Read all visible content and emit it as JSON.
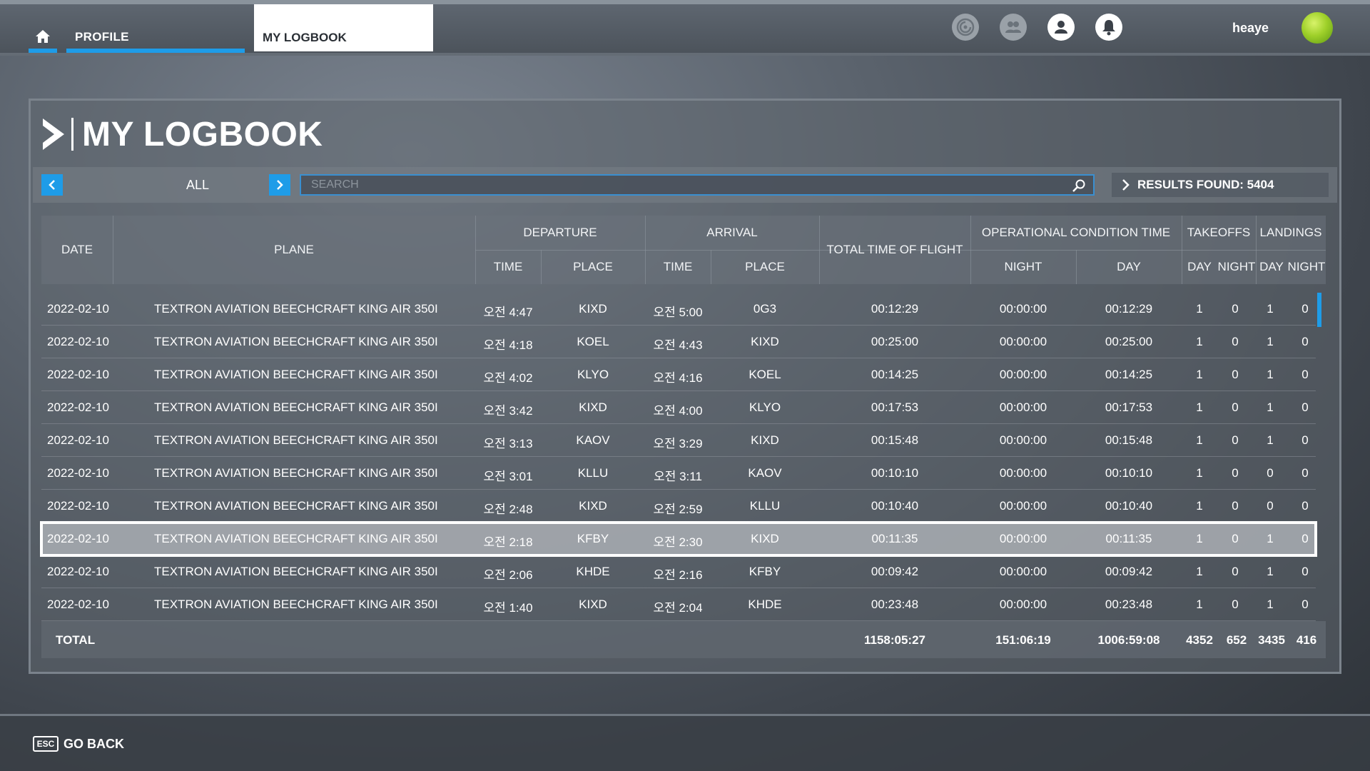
{
  "topbar": {
    "tabs": [
      {
        "label": "PROFILE"
      },
      {
        "label": "MY LOGBOOK"
      }
    ],
    "username": "heaye",
    "icons": [
      "home-icon",
      "activity-icon",
      "friends-icon",
      "profile-icon",
      "notification-icon"
    ]
  },
  "page": {
    "title": "MY LOGBOOK"
  },
  "filter": {
    "label": "ALL",
    "search_placeholder": "SEARCH",
    "results": "RESULTS FOUND: 5404"
  },
  "table": {
    "headers": {
      "date": "DATE",
      "plane": "PLANE",
      "departure": "DEPARTURE",
      "arrival": "ARRIVAL",
      "total_time": "TOTAL TIME OF FLIGHT",
      "op_time": "OPERATIONAL CONDITION TIME",
      "takeoffs": "TAKEOFFS",
      "landings": "LANDINGS",
      "time": "TIME",
      "place": "PLACE",
      "night": "NIGHT",
      "day": "DAY",
      "day_short": "DAY",
      "night_short": "NIGHT"
    },
    "rows": [
      {
        "date": "2022-02-10",
        "plane": "TEXTRON AVIATION BEECHCRAFT KING AIR 350I",
        "dep_time": "오전 4:47",
        "dep_place": "KIXD",
        "arr_time": "오전 5:00",
        "arr_place": "0G3",
        "total": "00:12:29",
        "night": "00:00:00",
        "day": "00:12:29",
        "to_day": "1",
        "to_night": "0",
        "ld_day": "1",
        "ld_night": "0"
      },
      {
        "date": "2022-02-10",
        "plane": "TEXTRON AVIATION BEECHCRAFT KING AIR 350I",
        "dep_time": "오전 4:18",
        "dep_place": "KOEL",
        "arr_time": "오전 4:43",
        "arr_place": "KIXD",
        "total": "00:25:00",
        "night": "00:00:00",
        "day": "00:25:00",
        "to_day": "1",
        "to_night": "0",
        "ld_day": "1",
        "ld_night": "0"
      },
      {
        "date": "2022-02-10",
        "plane": "TEXTRON AVIATION BEECHCRAFT KING AIR 350I",
        "dep_time": "오전 4:02",
        "dep_place": "KLYO",
        "arr_time": "오전 4:16",
        "arr_place": "KOEL",
        "total": "00:14:25",
        "night": "00:00:00",
        "day": "00:14:25",
        "to_day": "1",
        "to_night": "0",
        "ld_day": "1",
        "ld_night": "0"
      },
      {
        "date": "2022-02-10",
        "plane": "TEXTRON AVIATION BEECHCRAFT KING AIR 350I",
        "dep_time": "오전 3:42",
        "dep_place": "KIXD",
        "arr_time": "오전 4:00",
        "arr_place": "KLYO",
        "total": "00:17:53",
        "night": "00:00:00",
        "day": "00:17:53",
        "to_day": "1",
        "to_night": "0",
        "ld_day": "1",
        "ld_night": "0"
      },
      {
        "date": "2022-02-10",
        "plane": "TEXTRON AVIATION BEECHCRAFT KING AIR 350I",
        "dep_time": "오전 3:13",
        "dep_place": "KAOV",
        "arr_time": "오전 3:29",
        "arr_place": "KIXD",
        "total": "00:15:48",
        "night": "00:00:00",
        "day": "00:15:48",
        "to_day": "1",
        "to_night": "0",
        "ld_day": "1",
        "ld_night": "0"
      },
      {
        "date": "2022-02-10",
        "plane": "TEXTRON AVIATION BEECHCRAFT KING AIR 350I",
        "dep_time": "오전 3:01",
        "dep_place": "KLLU",
        "arr_time": "오전 3:11",
        "arr_place": "KAOV",
        "total": "00:10:10",
        "night": "00:00:00",
        "day": "00:10:10",
        "to_day": "1",
        "to_night": "0",
        "ld_day": "0",
        "ld_night": "0"
      },
      {
        "date": "2022-02-10",
        "plane": "TEXTRON AVIATION BEECHCRAFT KING AIR 350I",
        "dep_time": "오전 2:48",
        "dep_place": "KIXD",
        "arr_time": "오전 2:59",
        "arr_place": "KLLU",
        "total": "00:10:40",
        "night": "00:00:00",
        "day": "00:10:40",
        "to_day": "1",
        "to_night": "0",
        "ld_day": "0",
        "ld_night": "0"
      },
      {
        "date": "2022-02-10",
        "plane": "TEXTRON AVIATION BEECHCRAFT KING AIR 350I",
        "dep_time": "오전 2:18",
        "dep_place": "KFBY",
        "arr_time": "오전 2:30",
        "arr_place": "KIXD",
        "total": "00:11:35",
        "night": "00:00:00",
        "day": "00:11:35",
        "to_day": "1",
        "to_night": "0",
        "ld_day": "1",
        "ld_night": "0"
      },
      {
        "date": "2022-02-10",
        "plane": "TEXTRON AVIATION BEECHCRAFT KING AIR 350I",
        "dep_time": "오전 2:06",
        "dep_place": "KHDE",
        "arr_time": "오전 2:16",
        "arr_place": "KFBY",
        "total": "00:09:42",
        "night": "00:00:00",
        "day": "00:09:42",
        "to_day": "1",
        "to_night": "0",
        "ld_day": "1",
        "ld_night": "0"
      },
      {
        "date": "2022-02-10",
        "plane": "TEXTRON AVIATION BEECHCRAFT KING AIR 350I",
        "dep_time": "오전 1:40",
        "dep_place": "KIXD",
        "arr_time": "오전 2:04",
        "arr_place": "KHDE",
        "total": "00:23:48",
        "night": "00:00:00",
        "day": "00:23:48",
        "to_day": "1",
        "to_night": "0",
        "ld_day": "1",
        "ld_night": "0"
      }
    ],
    "selected_row_index": 7,
    "totals": {
      "label": "TOTAL",
      "total": "1158:05:27",
      "night": "151:06:19",
      "day": "1006:59:08",
      "to_day": "4352",
      "to_night": "652",
      "ld_day": "3435",
      "ld_night": "416"
    }
  },
  "footer": {
    "key": "ESC",
    "label": "GO BACK"
  },
  "colors": {
    "accent": "#1e9ce8",
    "selected_row": "#a5aaaf"
  }
}
